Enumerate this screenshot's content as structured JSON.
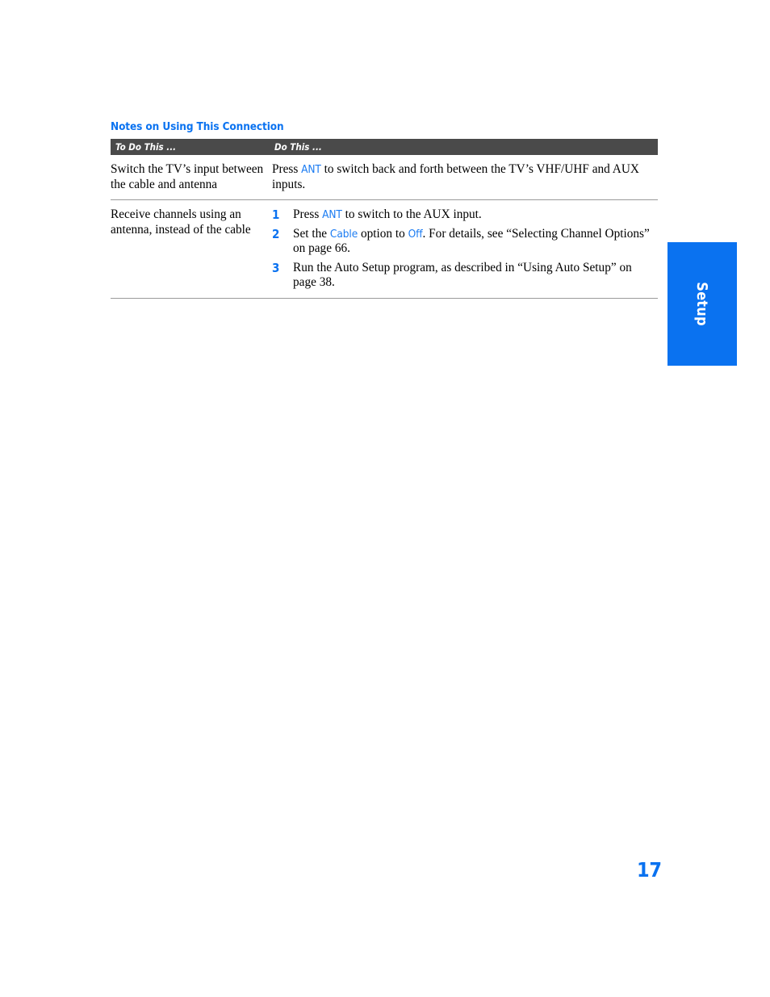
{
  "page": {
    "number": "17",
    "thumb_tab_label": "Setup",
    "accent_color": "#0a72f0",
    "header_bar_color": "#4a4a4a",
    "rule_color": "#9a9a9a"
  },
  "section": {
    "heading": "Notes on Using This Connection"
  },
  "table": {
    "columns": [
      {
        "header": "To Do This ..."
      },
      {
        "header": "Do This ..."
      }
    ],
    "rows": [
      {
        "to_do": "Switch the TV’s input between the cable and antenna",
        "do_this_type": "paragraph",
        "do_this_parts": [
          {
            "text": "Press ",
            "style": "normal"
          },
          {
            "text": "ANT",
            "style": "key"
          },
          {
            "text": " to switch back and forth between the TV’s VHF/UHF and AUX inputs.",
            "style": "normal"
          }
        ]
      },
      {
        "to_do": "Receive channels using an antenna, instead of the cable",
        "do_this_type": "steps",
        "steps": [
          {
            "number": "1",
            "parts": [
              {
                "text": "Press ",
                "style": "normal"
              },
              {
                "text": "ANT",
                "style": "key"
              },
              {
                "text": " to switch to the AUX input.",
                "style": "normal"
              }
            ]
          },
          {
            "number": "2",
            "parts": [
              {
                "text": "Set the ",
                "style": "normal"
              },
              {
                "text": "Cable",
                "style": "key"
              },
              {
                "text": " option to ",
                "style": "normal"
              },
              {
                "text": "Off",
                "style": "key"
              },
              {
                "text": ". For details, see “Selecting Channel Options” on page 66.",
                "style": "normal"
              }
            ]
          },
          {
            "number": "3",
            "parts": [
              {
                "text": "Run the Auto Setup program, as described in “Using Auto Setup” on page 38.",
                "style": "normal"
              }
            ]
          }
        ]
      }
    ]
  }
}
